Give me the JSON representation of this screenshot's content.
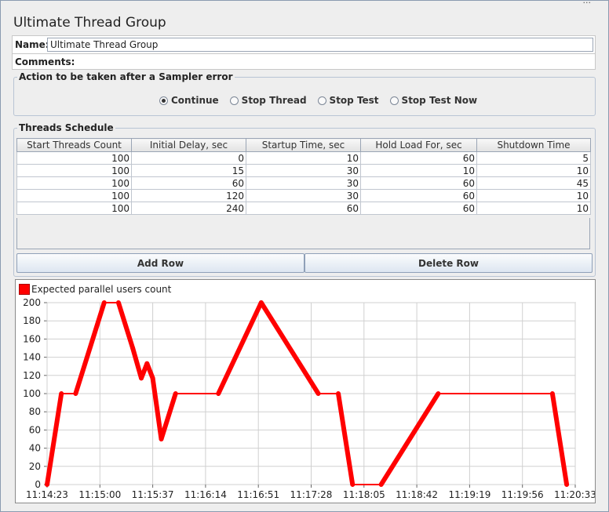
{
  "window": {
    "corner_text": "..."
  },
  "title": "Ultimate Thread Group",
  "name_field": {
    "label": "Name:",
    "value": "Ultimate Thread Group"
  },
  "comments": {
    "label": "Comments:"
  },
  "sampler_error": {
    "legend": "Action to be taken after a Sampler error",
    "options": [
      {
        "label": "Continue",
        "selected": true
      },
      {
        "label": "Stop Thread",
        "selected": false
      },
      {
        "label": "Stop Test",
        "selected": false
      },
      {
        "label": "Stop Test Now",
        "selected": false
      }
    ]
  },
  "schedule": {
    "legend": "Threads Schedule",
    "columns": [
      "Start Threads Count",
      "Initial Delay, sec",
      "Startup Time, sec",
      "Hold Load For, sec",
      "Shutdown Time"
    ],
    "rows": [
      [
        "100",
        "0",
        "10",
        "60",
        "5"
      ],
      [
        "100",
        "15",
        "30",
        "10",
        "10"
      ],
      [
        "100",
        "60",
        "30",
        "60",
        "45"
      ],
      [
        "100",
        "120",
        "30",
        "60",
        "10"
      ],
      [
        "100",
        "240",
        "60",
        "60",
        "10"
      ]
    ],
    "add_row_label": "Add Row",
    "delete_row_label": "Delete Row"
  },
  "chart_data": {
    "type": "line",
    "series": [
      {
        "name": "Expected parallel users count",
        "color": "#ff0000",
        "points": [
          [
            0,
            0
          ],
          [
            5,
            100
          ],
          [
            10,
            100
          ],
          [
            20,
            200
          ],
          [
            25,
            200
          ],
          [
            30,
            150
          ],
          [
            33,
            117
          ],
          [
            35,
            133
          ],
          [
            37,
            117
          ],
          [
            40,
            50
          ],
          [
            45,
            100
          ],
          [
            60,
            100
          ],
          [
            75,
            200
          ],
          [
            95,
            100
          ],
          [
            102,
            100
          ],
          [
            107,
            0
          ],
          [
            117,
            0
          ],
          [
            137,
            100
          ],
          [
            177,
            100
          ],
          [
            182,
            0
          ]
        ]
      }
    ],
    "x_tick_labels": [
      "11:14:23",
      "11:15:00",
      "11:15:37",
      "11:16:14",
      "11:16:51",
      "11:17:28",
      "11:18:05",
      "11:18:42",
      "11:19:19",
      "11:19:56",
      "11:20:33"
    ],
    "x_ticks_seconds": [
      0,
      18.5,
      37,
      55.5,
      74,
      92.5,
      111,
      129.5,
      148,
      166.5,
      185
    ],
    "y_ticks": [
      0,
      20,
      40,
      60,
      80,
      100,
      120,
      140,
      160,
      180,
      200
    ],
    "ylim": [
      0,
      200
    ],
    "xlim": [
      0,
      185
    ],
    "grid": true,
    "legend_position": "top-left"
  }
}
